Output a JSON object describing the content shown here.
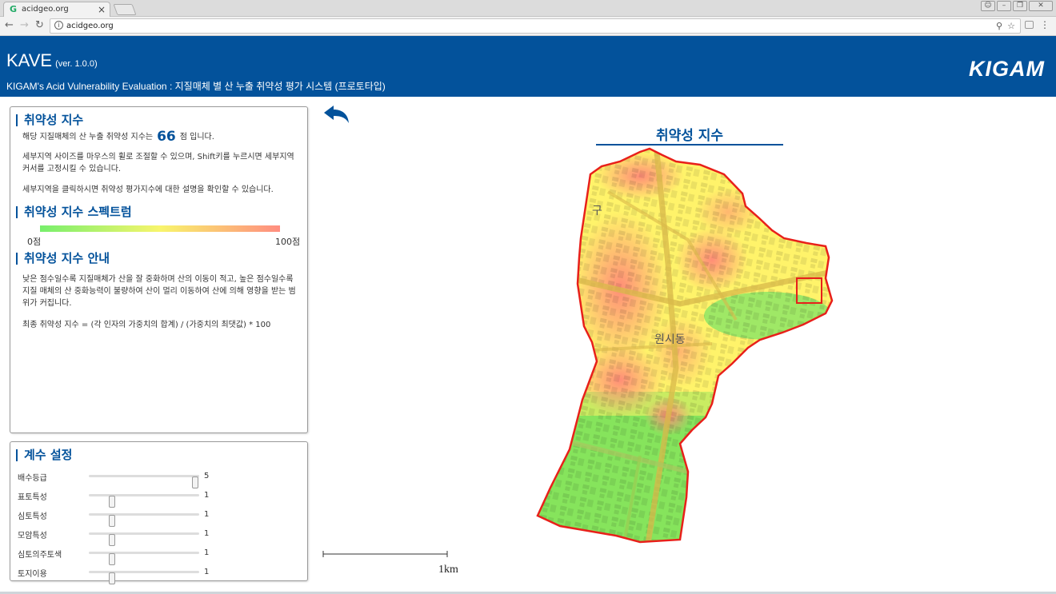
{
  "browser": {
    "tab_title": "acidgeo.org",
    "tab_close": "×",
    "url": "acidgeo.org"
  },
  "header": {
    "title": "KAVE",
    "version": "(ver. 1.0.0)",
    "subtitle": "KIGAM's Acid Vulnerability Evaluation : 지질매체 별 산 누출 취약성 평가 시스템 (프로토타입)",
    "logo": "KIGAM",
    "color": "#03529b"
  },
  "index_section": {
    "title": "취약성 지수",
    "score_prefix": "해당 지질매체의 산 누출 취약성 지수는",
    "score": "66",
    "score_suffix": "점 입니다.",
    "help1": "세부지역 사이즈를 마우스의 휠로 조절할 수 있으며, Shift키를 누르시면 세부지역 커서를 고정시킬 수 있습니다.",
    "help2": "세부지역을 클릭하시면 취약성 평가지수에 대한 설명을 확인할 수 있습니다."
  },
  "spectrum_section": {
    "title": "취약성 지수 스펙트럼",
    "min_label": "0점",
    "max_label": "100점",
    "colors": [
      "#77ef6c",
      "#f8f56c",
      "#ff8d80"
    ]
  },
  "guide_section": {
    "title": "취약성 지수 안내",
    "text": "낮은 점수일수록 지질매체가 산을 잘 중화하며 산의 이동이 적고, 높은 점수일수록 지질 매체의 산 중화능력이 불량하여 산이 멀리 이동하여 산에 의해 영향을 받는 범위가 커집니다.",
    "formula": "최종 취약성 지수 = (각 인자의 가중치의 합계) / (가중치의 최댓값) * 100"
  },
  "coef_section": {
    "title": "계수 설정",
    "rows": [
      {
        "label": "배수등급",
        "value": "5",
        "level": 1.0
      },
      {
        "label": "표토특성",
        "value": "1",
        "level": 0.2
      },
      {
        "label": "심토특성",
        "value": "1",
        "level": 0.2
      },
      {
        "label": "모암특성",
        "value": "1",
        "level": 0.2
      },
      {
        "label": "심토의주토색",
        "value": "1",
        "level": 0.2
      },
      {
        "label": "토지이용",
        "value": "1",
        "level": 0.2
      }
    ]
  },
  "map": {
    "title": "취약성 지수",
    "place_label": "원시동",
    "scale_label": "1km",
    "boundary_color": "#e8201a"
  }
}
